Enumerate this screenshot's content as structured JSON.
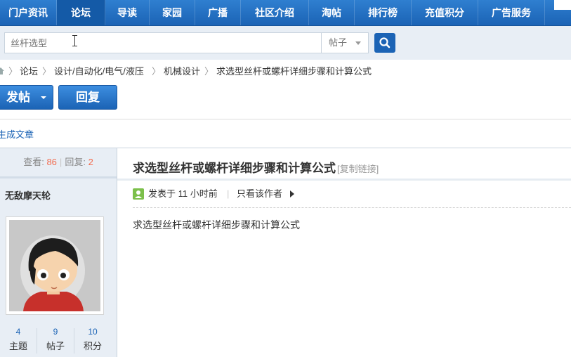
{
  "topnav": {
    "items": [
      {
        "label": "门户资讯",
        "active": false
      },
      {
        "label": "论坛",
        "active": true
      },
      {
        "label": "导读",
        "active": false
      },
      {
        "label": "家园",
        "active": false
      },
      {
        "label": "广播",
        "active": false
      },
      {
        "label": "社区介绍",
        "active": false
      },
      {
        "label": "淘帖",
        "active": false
      },
      {
        "label": "排行榜",
        "active": false
      },
      {
        "label": "充值积分",
        "active": false
      },
      {
        "label": "广告服务",
        "active": false
      }
    ]
  },
  "search": {
    "placeholder": "丝杆选型",
    "type_label": "帖子"
  },
  "breadcrumb": {
    "items": [
      "论坛",
      "设计/自动化/电气/液压",
      "机械设计",
      "求选型丝杆或螺杆详细步骤和计算公式"
    ]
  },
  "actions": {
    "post_label": "发帖",
    "reply_label": "回复"
  },
  "related_link": "生成文章",
  "thread": {
    "views_label": "查看:",
    "views": "86",
    "replies_label": "回复:",
    "replies": "2",
    "title": "求选型丝杆或螺杆详细步骤和计算公式",
    "copy_link": "[复制链接]",
    "posted": "发表于 11 小时前",
    "only_author": "只看该作者",
    "body": "求选型丝杆或螺杆详细步骤和计算公式"
  },
  "author": {
    "name": "无敌摩天轮",
    "stats": [
      {
        "value": "4",
        "label": "主题"
      },
      {
        "value": "9",
        "label": "帖子"
      },
      {
        "value": "10",
        "label": "积分"
      }
    ]
  },
  "colors": {
    "nav_blue": "#1b63b5",
    "accent_number": "#f26c4f",
    "sidebar_bg": "#e8eef5"
  }
}
